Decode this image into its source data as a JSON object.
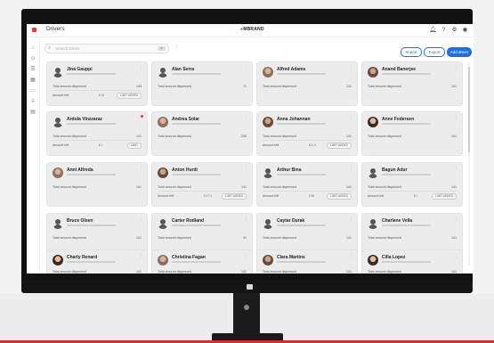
{
  "header": {
    "page_title": "Drivers",
    "brand_prefix": "",
    "brand_main": "MBRAND",
    "icons": [
      "bell-icon",
      "help-icon",
      "settings-icon",
      "profile-icon"
    ]
  },
  "sidebar": {
    "icons": [
      "home-icon",
      "user-icon",
      "document-icon",
      "calendar-icon",
      "truck-icon",
      "list-icon",
      "chart-icon"
    ]
  },
  "toolbar": {
    "search_placeholder": "Search Driver",
    "search_clear": "clear",
    "buttons": [
      "Import",
      "Export",
      "Add driver"
    ]
  },
  "labels": {
    "total_amount": "Total amount dispensed",
    "amount_left": "Amount left",
    "limit_chip": "LIMIT ADDED"
  },
  "cards": [
    {
      "name": "Jina Gauppi",
      "value": "143",
      "has_amount": true,
      "amount_mid": "$ 25",
      "chip": "LIMIT ADDED",
      "avatar": "placeholder"
    },
    {
      "name": "Alan Serra",
      "value": "71",
      "has_amount": false,
      "avatar": "placeholder"
    },
    {
      "name": "Alfred Adams",
      "value": "141",
      "has_amount": false,
      "avatar": "photo"
    },
    {
      "name": "Anand Banerjee",
      "value": "141",
      "has_amount": false,
      "avatar": "photo"
    },
    {
      "name": "Ardula Vinzzaraz",
      "value": "141",
      "has_amount": true,
      "amount_mid": "$ 1",
      "chip": "LIMIT",
      "avatar": "placeholder",
      "alert": true
    },
    {
      "name": "Andrea Solar",
      "value": "236",
      "has_amount": false,
      "avatar": "photo"
    },
    {
      "name": "Anna Johannan",
      "value": "141",
      "has_amount": true,
      "amount_mid": "$14.5",
      "chip": "LIMIT ADDED",
      "avatar": "photo"
    },
    {
      "name": "Anne Federsen",
      "value": "141",
      "has_amount": false,
      "avatar": "photo"
    },
    {
      "name": "Anni Alfreda",
      "value": "141",
      "has_amount": false,
      "avatar": "photo"
    },
    {
      "name": "Anton Hurdi",
      "value": "141",
      "has_amount": true,
      "amount_mid": "$ 47.5",
      "chip": "LIMIT ADDED",
      "avatar": "photo"
    },
    {
      "name": "Arthur Bina",
      "value": "141",
      "has_amount": true,
      "amount_mid": "$ 85",
      "chip": "LIMIT ADDED",
      "avatar": "placeholder"
    },
    {
      "name": "Bagun Adur",
      "value": "141",
      "has_amount": true,
      "amount_mid": "$ 1",
      "chip": "LIMIT ADDED",
      "avatar": "placeholder"
    },
    {
      "name": "Bruce Olsen",
      "value": "141",
      "has_amount": false,
      "avatar": "placeholder"
    },
    {
      "name": "Carter Rodland",
      "value": "91",
      "has_amount": false,
      "avatar": "placeholder"
    },
    {
      "name": "Caytar Durak",
      "value": "141",
      "has_amount": false,
      "avatar": "placeholder"
    },
    {
      "name": "Charlene Vella",
      "value": "141",
      "has_amount": false,
      "avatar": "placeholder"
    },
    {
      "name": "Charly Renard",
      "value": "141",
      "has_amount": false,
      "avatar": "photo"
    },
    {
      "name": "Christina Fagan",
      "value": "141",
      "has_amount": false,
      "avatar": "photo"
    },
    {
      "name": "Clara Martins",
      "value": "141",
      "has_amount": false,
      "avatar": "photo"
    },
    {
      "name": "Cilla Lopez",
      "value": "141",
      "has_amount": false,
      "avatar": "photo"
    }
  ]
}
